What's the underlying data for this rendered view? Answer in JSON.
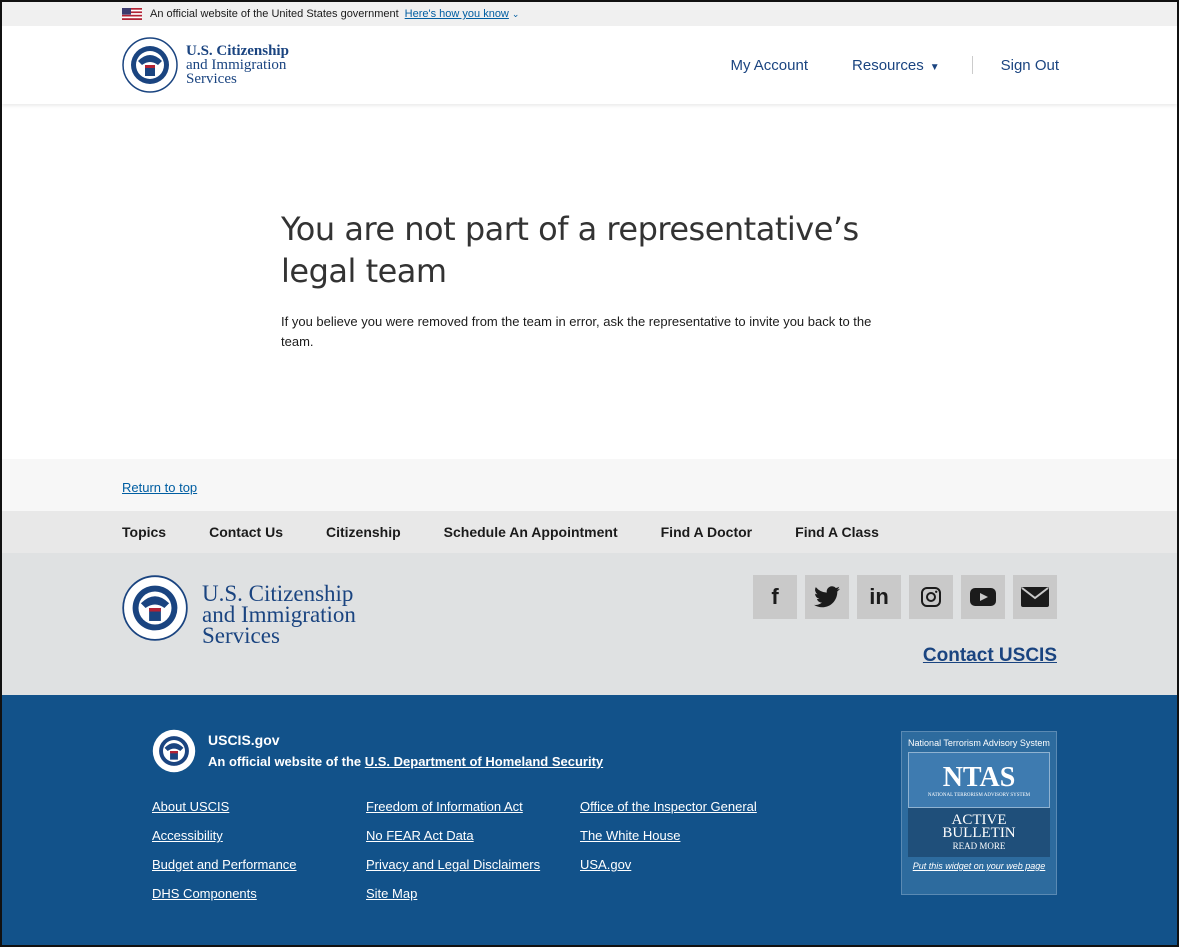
{
  "gov_banner": {
    "text": "An official website of the United States government",
    "link": "Here's how you know"
  },
  "header": {
    "logo_line1": "U.S. Citizenship",
    "logo_line2": "and Immigration",
    "logo_line3": "Services",
    "nav": {
      "my_account": "My Account",
      "resources": "Resources",
      "sign_out": "Sign Out"
    }
  },
  "main": {
    "heading": "You are not part of a representative’s legal team",
    "message": "If you believe you were removed from the team in error, ask the representative to invite you back to the team."
  },
  "return_to_top": "Return to top",
  "footer_nav": [
    "Topics",
    "Contact Us",
    "Citizenship",
    "Schedule An Appointment",
    "Find A Doctor",
    "Find A Class"
  ],
  "footer_logo": {
    "line1": "U.S. Citizenship",
    "line2": "and Immigration",
    "line3": "Services"
  },
  "social": [
    "facebook-icon",
    "twitter-icon",
    "linkedin-icon",
    "instagram-icon",
    "youtube-icon",
    "email-icon"
  ],
  "contact_uscis": "Contact USCIS",
  "identifier": {
    "site": "USCIS.gov",
    "official_prefix": "An official website of the",
    "dhs_link": "U.S. Department of Homeland Security"
  },
  "footer_links": {
    "col1": [
      "About USCIS",
      "Accessibility",
      "Budget and Performance",
      "DHS Components"
    ],
    "col2": [
      "Freedom of Information Act",
      "No FEAR Act Data",
      "Privacy and Legal Disclaimers",
      "Site Map"
    ],
    "col3": [
      "Office of the Inspector General",
      "The White House",
      "USA.gov"
    ]
  },
  "ntas": {
    "title": "National Terrorism Advisory System",
    "logo": "NTAS",
    "logo_sub": "NATIONAL TERRORISM ADVISORY SYSTEM",
    "active": "ACTIVE",
    "bulletin": "BULLETIN",
    "read_more": "READ MORE",
    "widget_link": "Put this widget on your web page"
  },
  "colors": {
    "primary": "#1a4480",
    "link": "#005ea2",
    "footer_blue": "#12528a"
  }
}
